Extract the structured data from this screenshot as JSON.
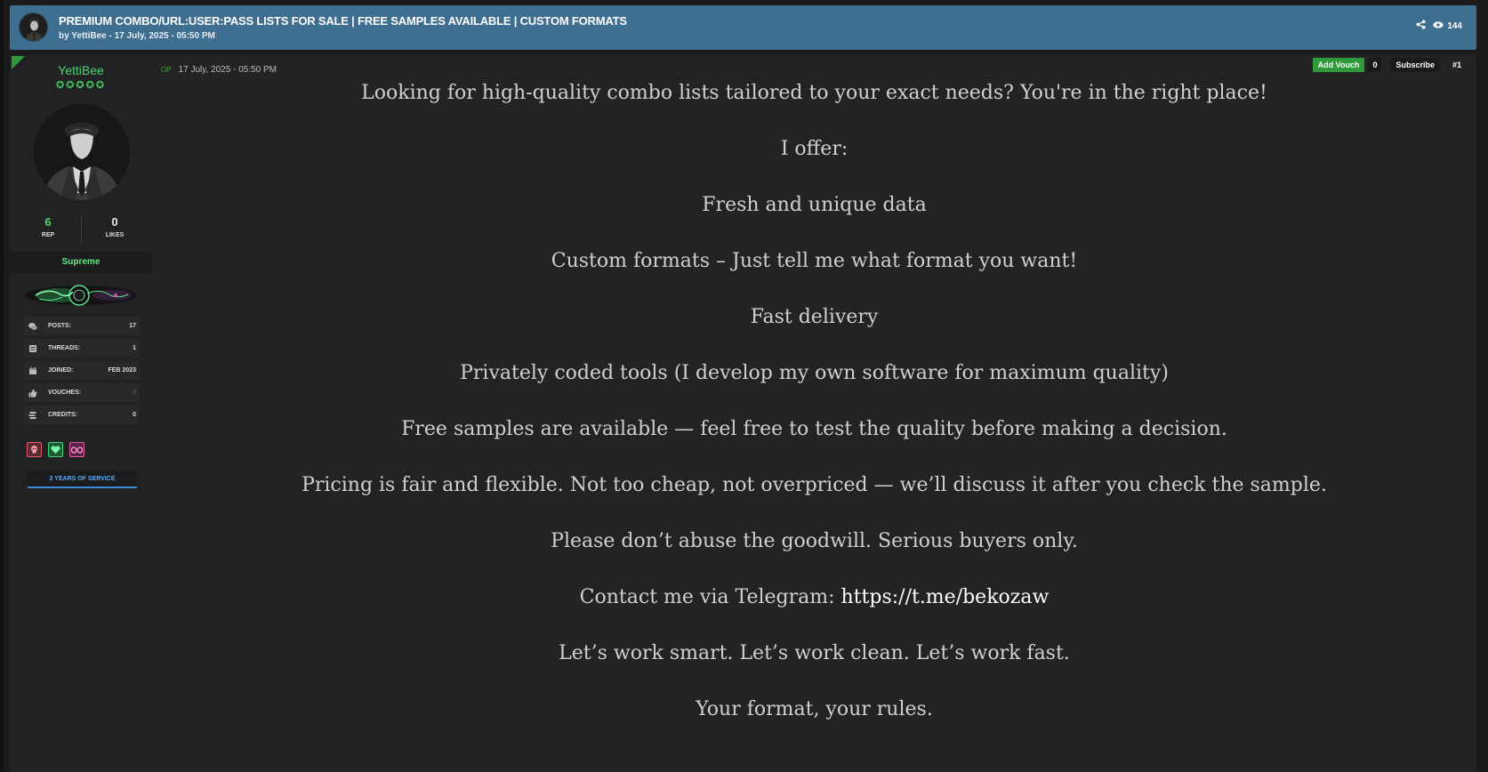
{
  "thread": {
    "title": "PREMIUM COMBO/URL:USER:PASS LISTS FOR SALE | FREE SAMPLES AVAILABLE | CUSTOM FORMATS",
    "byline": "by YettiBee - 17 July, 2025 - 05:50 PM",
    "views": "144"
  },
  "author": {
    "username": "YettiBee",
    "stars": "✪✪✪✪✪",
    "rep": "6",
    "rep_label": "REP",
    "likes": "0",
    "likes_label": "LIKES",
    "rank": "Supreme",
    "info": [
      {
        "label": "POSTS:",
        "value": "17",
        "icon": "comments-icon"
      },
      {
        "label": "THREADS:",
        "value": "1",
        "icon": "threads-icon"
      },
      {
        "label": "JOINED:",
        "value": "FEB 2023",
        "icon": "calendar-icon"
      },
      {
        "label": "VOUCHES:",
        "value": "0",
        "icon": "thumbs-up-icon"
      },
      {
        "label": "CREDITS:",
        "value": "0",
        "icon": "credits-icon"
      }
    ],
    "service_badge": "2 YEARS OF SERVICE"
  },
  "post": {
    "op_tag": "OP",
    "timestamp": "17 July, 2025 - 05:50 PM",
    "add_vouch": "Add Vouch",
    "vouch_count": "0",
    "subscribe": "Subscribe",
    "post_number": "#1",
    "lines": [
      "Looking for high-quality combo lists tailored to your exact needs? You're in the right place!",
      "I offer:",
      "Fresh and unique data",
      "Custom formats – Just tell me what format you want!",
      "Fast delivery",
      "Privately coded tools (I develop my own software for maximum quality)",
      "Free samples are available — feel free to test the quality before making a decision.",
      "Pricing is fair and flexible. Not too cheap, not overpriced — we’ll discuss it after you check the sample.",
      "Please don’t abuse the goodwill. Serious buyers only."
    ],
    "contact_prefix": "Contact me via Telegram: ",
    "contact_link": "https://t.me/bekozaw",
    "lines_after": [
      "Let’s work smart. Let’s work clean. Let’s work fast.",
      "Your format, your rules."
    ]
  },
  "colors": {
    "header_bg": "#3e6e90",
    "accent_green": "#4fd36c",
    "service_blue": "#5aa8f5"
  }
}
